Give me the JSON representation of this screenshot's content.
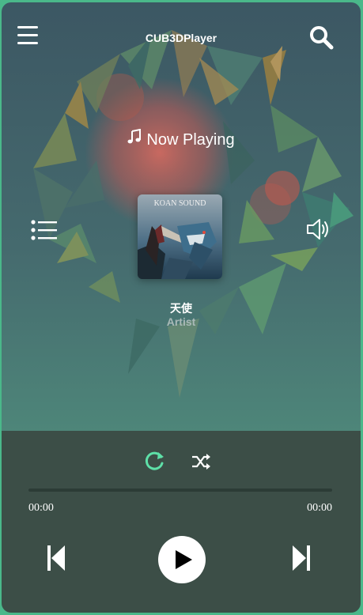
{
  "app": {
    "title": "CUB3DPlayer"
  },
  "header": {
    "menu_icon": "hamburger-icon",
    "search_icon": "search-icon"
  },
  "now_playing": {
    "label": "Now Playing",
    "icon": "music-note-icon"
  },
  "track": {
    "title": "天使",
    "artist": "Artist",
    "cover_text": "KOAN SOUND"
  },
  "side": {
    "playlist_icon": "playlist-icon",
    "volume_icon": "volume-icon"
  },
  "player": {
    "repeat_icon": "repeat-icon",
    "shuffle_icon": "shuffle-icon",
    "current_time": "00:00",
    "total_time": "00:00",
    "progress": 0,
    "prev_icon": "skip-previous-icon",
    "play_icon": "play-icon",
    "next_icon": "skip-next-icon"
  },
  "colors": {
    "accent": "#5ee0a8",
    "frame_border": "#4ab88a",
    "controls_bg": "#3c4e47",
    "artist_text": "#a9b9b7"
  }
}
